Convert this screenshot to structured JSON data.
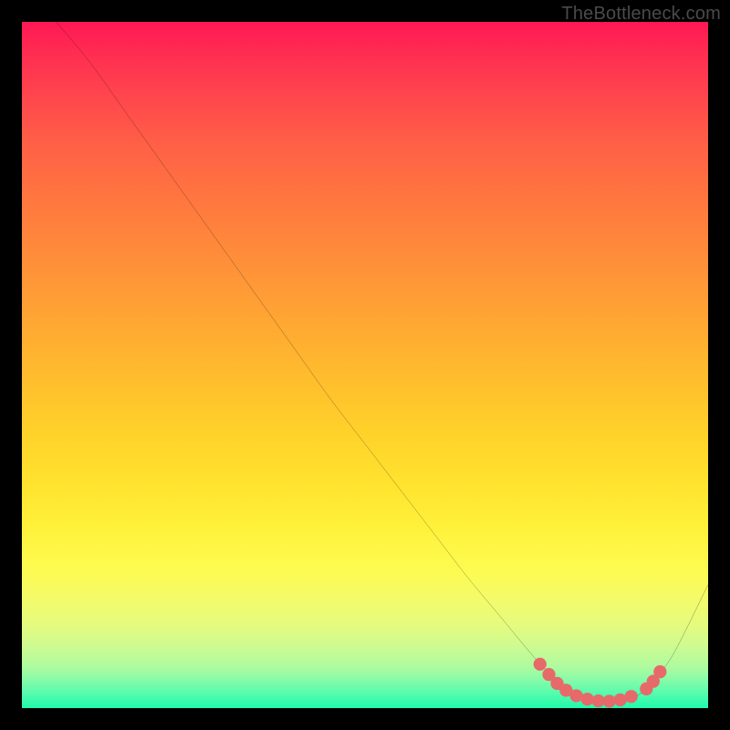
{
  "attribution": "TheBottleneck.com",
  "colors": {
    "background": "#000000",
    "curve": "#000000",
    "marker": "#e76a6a"
  },
  "chart_data": {
    "type": "line",
    "title": "",
    "xlabel": "",
    "ylabel": "",
    "xlim": [
      0,
      100
    ],
    "ylim": [
      0,
      100
    ],
    "grid": false,
    "series": [
      {
        "name": "bottleneck-curve",
        "x": [
          5,
          10,
          15,
          20,
          25,
          30,
          35,
          40,
          45,
          50,
          55,
          60,
          65,
          70,
          75,
          78,
          80,
          82,
          84,
          86,
          88,
          90,
          92,
          95,
          100
        ],
        "values": [
          100,
          94,
          87,
          80,
          73,
          66,
          59,
          52,
          45,
          38.5,
          32,
          25.5,
          19,
          13,
          7,
          4,
          2.5,
          1.5,
          1,
          1,
          1.2,
          2,
          4,
          8,
          18
        ]
      }
    ],
    "markers": {
      "name": "optimal-range",
      "color": "#e76a6a",
      "points": [
        {
          "x": 75.5,
          "y": 6.4
        },
        {
          "x": 76.8,
          "y": 4.9
        },
        {
          "x": 78.0,
          "y": 3.6
        },
        {
          "x": 79.3,
          "y": 2.6
        },
        {
          "x": 80.8,
          "y": 1.8
        },
        {
          "x": 82.4,
          "y": 1.3
        },
        {
          "x": 84.0,
          "y": 1.05
        },
        {
          "x": 85.6,
          "y": 1.0
        },
        {
          "x": 87.2,
          "y": 1.2
        },
        {
          "x": 88.8,
          "y": 1.7
        },
        {
          "x": 91.0,
          "y": 2.8
        },
        {
          "x": 92.0,
          "y": 3.9
        },
        {
          "x": 93.0,
          "y": 5.3
        }
      ]
    }
  }
}
